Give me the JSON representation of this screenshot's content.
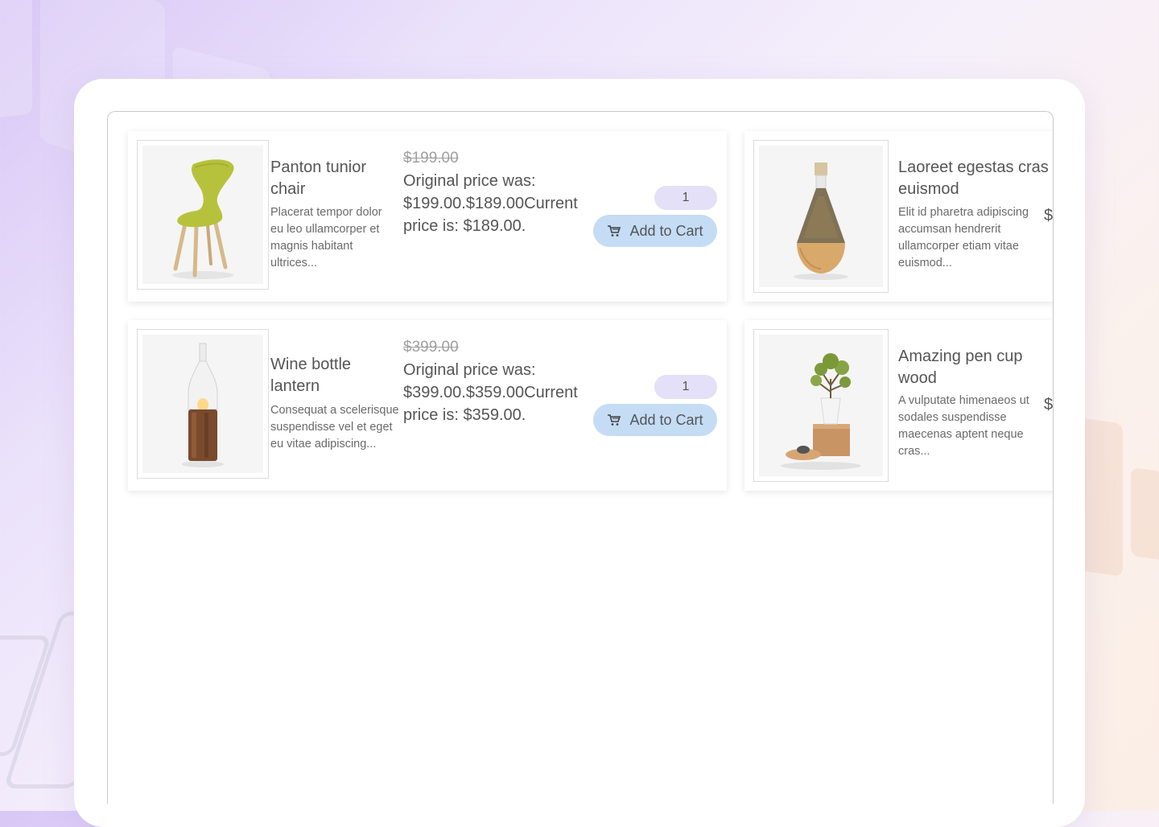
{
  "products": [
    {
      "title": "Panton tunior chair",
      "description": "Placerat tempor dolor eu leo ullamcorper et magnis habitant ultrices...",
      "old_price": "$199.00",
      "price_text": "Original price was: $199.00.$189.00Current price is: $189.00.",
      "quantity": "1",
      "button_label": "Add to Cart",
      "image": "chair"
    },
    {
      "title": "Laoreet egestas cras euismod",
      "description": "Elit id pharetra adipiscing accumsan hendrerit ullamcorper etiam vitae euismod...",
      "price_partial": "$",
      "image": "jar"
    },
    {
      "title": "Wine bottle lantern",
      "description": "Consequat a scelerisque suspendisse vel et eget eu vitae adipiscing...",
      "old_price": "$399.00",
      "price_text": "Original price was: $399.00.$359.00Current price is: $359.00.",
      "quantity": "1",
      "button_label": "Add to Cart",
      "image": "lantern"
    },
    {
      "title": "Amazing pen cup wood",
      "description": "A vulputate himenaeos ut sodales suspendisse maecenas aptent neque cras...",
      "price_partial": "$",
      "image": "plant"
    }
  ],
  "colors": {
    "button_bg": "#c5dcf5",
    "quantity_bg": "#e3e0f8",
    "text": "#555555"
  },
  "icons": [
    "cart-icon"
  ]
}
